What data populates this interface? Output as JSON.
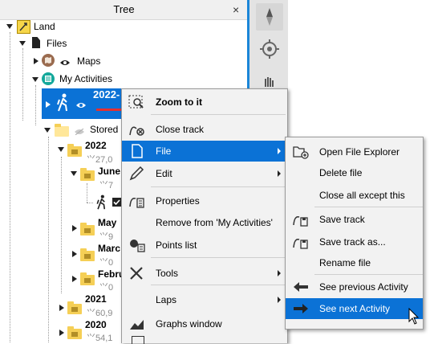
{
  "tree": {
    "title": "Tree",
    "close": "×",
    "root_label": "Land",
    "files_label": "Files",
    "maps_label": "Maps",
    "activities_label": "My Activities",
    "activity_label": "2022-",
    "stored_label": "Stored",
    "year_2022": "2022",
    "stat_2022": "27,0",
    "june_label": "June",
    "stat_june": "7",
    "may_label": "May",
    "stat_may": "9",
    "march_label": "Marc",
    "stat_march": "0",
    "feb_label": "Febru",
    "stat_feb": "0",
    "year_2021": "2021",
    "stat_2021": "60,9",
    "year_2020": "2020",
    "stat_2020": "54,1"
  },
  "context_menu": {
    "zoom_to_it": "Zoom to it",
    "close_track": "Close track",
    "file": "File",
    "edit": "Edit",
    "properties": "Properties",
    "remove": "Remove from 'My Activities'",
    "points_list": "Points list",
    "tools": "Tools",
    "laps": "Laps",
    "graphs_window": "Graphs window"
  },
  "file_submenu": {
    "open_explorer": "Open File Explorer",
    "delete_file": "Delete file",
    "close_all_except": "Close all except this",
    "save_track": "Save track",
    "save_track_as": "Save track as...",
    "rename_file": "Rename file",
    "see_previous": "See previous Activity",
    "see_next": "See next Activity"
  },
  "colors": {
    "highlight": "#0b72d6",
    "panel_border": "#1b86d8",
    "folder": "#f5cf56"
  }
}
